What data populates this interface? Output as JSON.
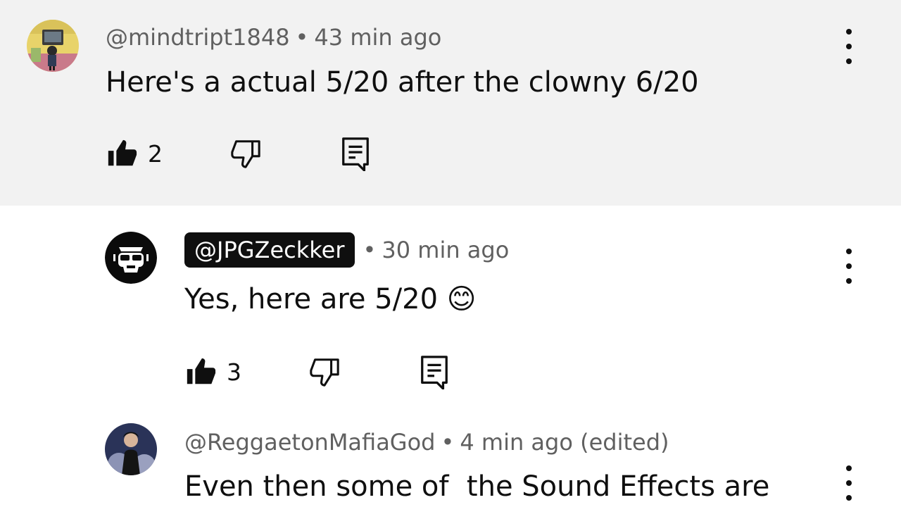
{
  "comments": [
    {
      "author": "@mindtript1848",
      "time": "43 min ago",
      "text": "Here's a actual 5/20 after the clowny 6/20",
      "likes": "2",
      "avatar": "avatar-gamer-room",
      "highlighted": true
    },
    {
      "author": "@JPGZeckker",
      "time": "30 min ago",
      "text": "Yes, here are 5/20 😊",
      "likes": "3",
      "avatar": "avatar-sunglasses-face",
      "creator_badge": true
    },
    {
      "author": "@ReggaetonMafiaGod",
      "time": "4 min ago (edited)",
      "text": "Even then some of  the Sound Effects are",
      "avatar": "avatar-person-dark"
    }
  ],
  "dot": "•",
  "icons": {
    "like": "thumbs-up-icon",
    "dislike": "thumbs-down-icon",
    "reply": "reply-icon",
    "more": "more-vertical-icon"
  },
  "colors": {
    "highlight_bg": "#f2f2f2",
    "meta": "#606060",
    "text": "#0f0f0f"
  }
}
